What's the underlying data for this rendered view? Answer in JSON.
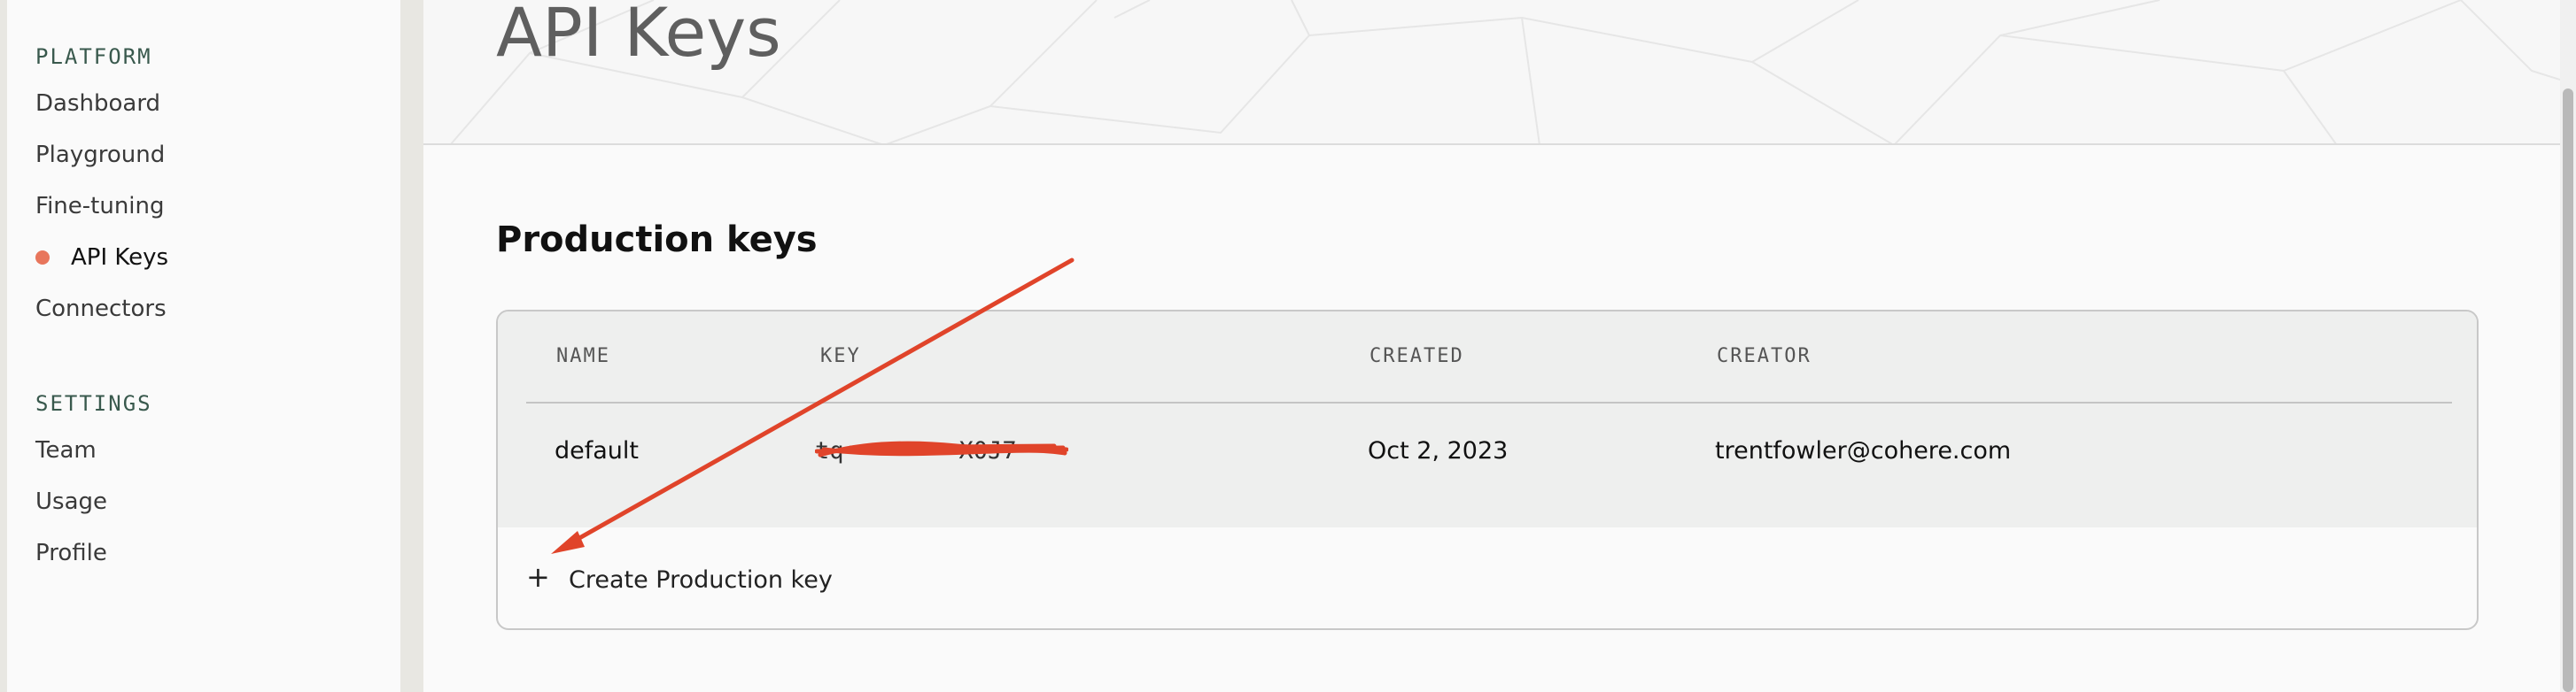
{
  "sidebar": {
    "platform_title": "PLATFORM",
    "platform_items": [
      {
        "label": "Dashboard"
      },
      {
        "label": "Playground"
      },
      {
        "label": "Fine-tuning"
      },
      {
        "label": "API Keys",
        "active": true
      },
      {
        "label": "Connectors"
      }
    ],
    "settings_title": "SETTINGS",
    "settings_items": [
      {
        "label": "Team"
      },
      {
        "label": "Usage"
      },
      {
        "label": "Profile"
      }
    ]
  },
  "page": {
    "title": "API Keys",
    "section_title": "Production keys"
  },
  "keys_table": {
    "columns": [
      "NAME",
      "KEY",
      "CREATED",
      "CREATOR"
    ],
    "rows": [
      {
        "name": "default",
        "key": "tq        X0J7",
        "created": "Oct 2, 2023",
        "creator": "trentfowler@cohere.com"
      }
    ],
    "create_label": "Create Production key",
    "create_icon": "+"
  },
  "colors": {
    "accent_dot": "#e8765c",
    "annotation": "#e0442a",
    "section_label": "#39594d"
  },
  "icons": {
    "active_indicator": "dot-icon",
    "create": "plus-icon"
  }
}
